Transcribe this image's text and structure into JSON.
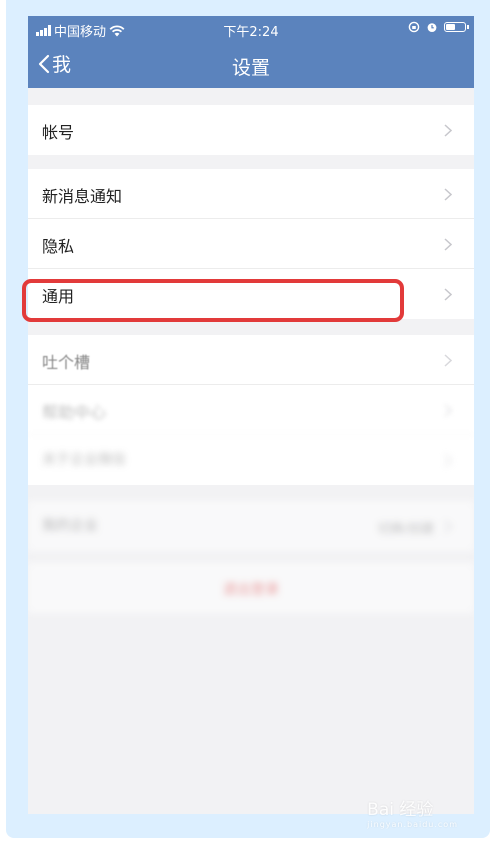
{
  "status_bar": {
    "carrier": "中国移动",
    "time": "下午2:24"
  },
  "nav": {
    "back_label": "我",
    "title": "设置"
  },
  "groups": [
    {
      "items": [
        {
          "label": "帐号"
        }
      ]
    },
    {
      "items": [
        {
          "label": "新消息通知"
        },
        {
          "label": "隐私"
        },
        {
          "label": "通用"
        }
      ]
    },
    {
      "items": [
        {
          "label": "吐个槽"
        },
        {
          "label": "帮助中心"
        },
        {
          "label": "关于企业微信"
        }
      ]
    },
    {
      "items": [
        {
          "label": "我的企业",
          "value": "切换/创建"
        }
      ]
    }
  ],
  "logout_label": "退出登录",
  "highlighted_item": "通用",
  "watermark": {
    "brand": "Bai 经验",
    "url": "jingyan.baidu.com"
  },
  "colors": {
    "nav_bg": "#5b83bd",
    "highlight": "#e23a3a",
    "logout_text": "#e45a5a",
    "frame_bg": "#dcefff"
  }
}
